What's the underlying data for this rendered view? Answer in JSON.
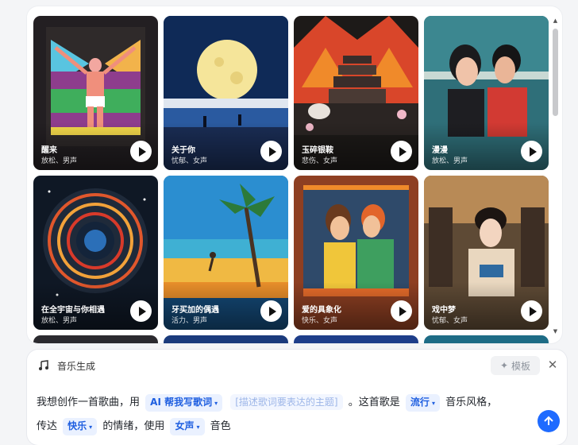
{
  "cards": [
    {
      "title": "醒来",
      "tags": "放松、男声"
    },
    {
      "title": "关于你",
      "tags": "忧郁、女声"
    },
    {
      "title": "玉碎银鞍",
      "tags": "悲伤、女声"
    },
    {
      "title": "漫漫",
      "tags": "放松、男声"
    },
    {
      "title": "在全宇宙与你相遇",
      "tags": "放松、男声"
    },
    {
      "title": "牙买加的偶遇",
      "tags": "活力、男声"
    },
    {
      "title": "爱的具象化",
      "tags": "快乐、女声"
    },
    {
      "title": "戏中梦",
      "tags": "忧郁、女声"
    }
  ],
  "composer": {
    "title": "音乐生成",
    "template_label": "模板",
    "line1_prefix": "我想创作一首歌曲，用",
    "lyrics_chip": "AI 帮我写歌词",
    "theme_placeholder": "[描述歌词要表达的主题]",
    "line1_mid": "。这首歌是",
    "style_chip": "流行",
    "line1_suffix": "音乐风格，",
    "line2_prefix": "传达",
    "mood_chip": "快乐",
    "line2_mid": "的情绪，使用",
    "voice_chip": "女声",
    "line2_suffix": "音色"
  },
  "colors": {
    "accent": "#1f6bff",
    "chip_text": "#1f5fe0"
  }
}
